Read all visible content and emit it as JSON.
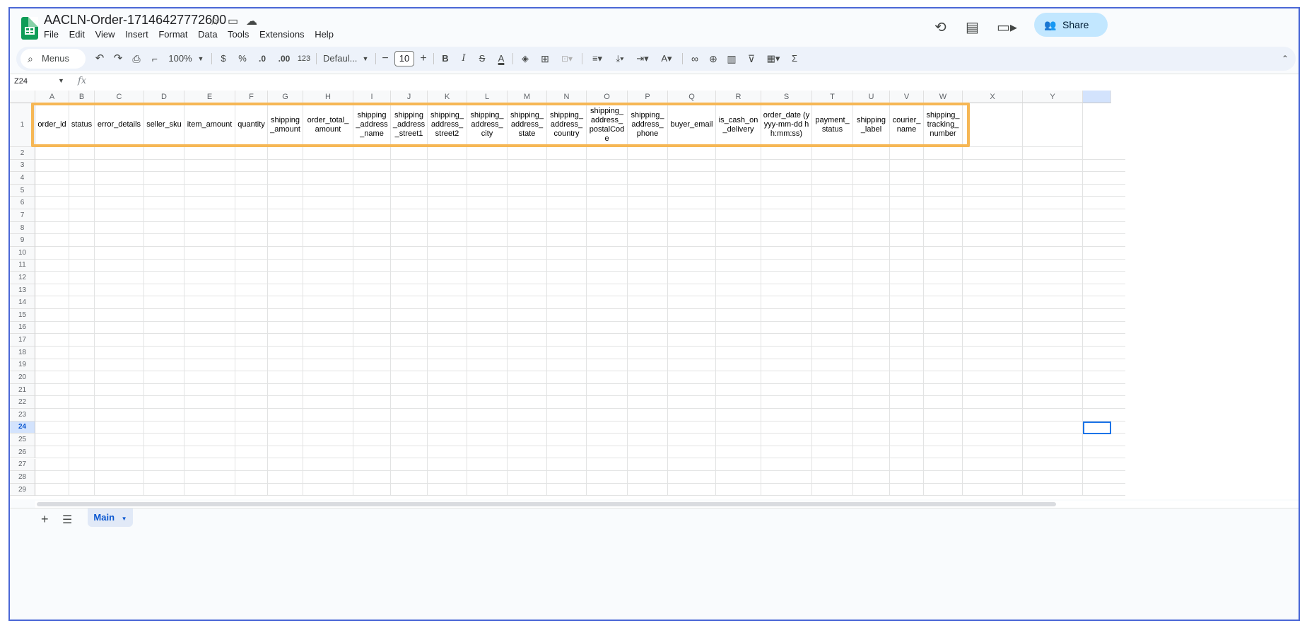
{
  "doc": {
    "title": "AACLN-Order-17146427772600"
  },
  "menu": [
    "File",
    "Edit",
    "View",
    "Insert",
    "Format",
    "Data",
    "Tools",
    "Extensions",
    "Help"
  ],
  "share": {
    "label": "Share"
  },
  "toolbar": {
    "search_label": "Menus",
    "zoom": "100%",
    "currency": "$",
    "percent": "%",
    "dec_decrease": ".0",
    "dec_increase": ".00",
    "number_format": "123",
    "font": "Defaul...",
    "font_size": "10",
    "bold": "B",
    "italic": "I",
    "sigma": "Σ"
  },
  "formula_bar": {
    "name_box": "Z24",
    "fx": "fx"
  },
  "columns": [
    "A",
    "B",
    "C",
    "D",
    "E",
    "F",
    "G",
    "H",
    "I",
    "J",
    "K",
    "L",
    "M",
    "N",
    "O",
    "P",
    "Q",
    "R",
    "S",
    "T",
    "U",
    "V",
    "W",
    "X",
    "Y"
  ],
  "rows": [
    "1",
    "2",
    "3",
    "4",
    "5",
    "6",
    "7",
    "8",
    "9",
    "10",
    "11",
    "12",
    "13",
    "14",
    "15",
    "16",
    "17",
    "18",
    "19",
    "20",
    "21",
    "22",
    "23",
    "24",
    "25",
    "26",
    "27",
    "28",
    "29"
  ],
  "header_row": [
    "order_id",
    "status",
    "error_details",
    "seller_sku",
    "item_amount",
    "quantity",
    "shipping _amount",
    "order_total_ amount",
    "shipping _address _name",
    "shipping _address _street1",
    "shipping_ address_ street2",
    "shipping_ address_ city",
    "shipping_ address_ state",
    "shipping_ address_ country",
    "shipping_ address_ postalCod e",
    "shipping_ address_ phone",
    "buyer_email",
    "is_cash_on _delivery",
    "order_date (yyyy-mm-dd hh:mm:ss)",
    "payment_ status",
    "shipping _label",
    "courier_ name",
    "shipping_ tracking_ number",
    "",
    ""
  ],
  "active_cell": {
    "col": "Z",
    "row": "24"
  },
  "sheets": [
    {
      "name": "Main",
      "active": true
    }
  ],
  "colors": {
    "accent": "#0b57d0",
    "highlight": "#f6b755",
    "sheets_green": "#0f9d58",
    "share_bg": "#c2e7ff"
  }
}
